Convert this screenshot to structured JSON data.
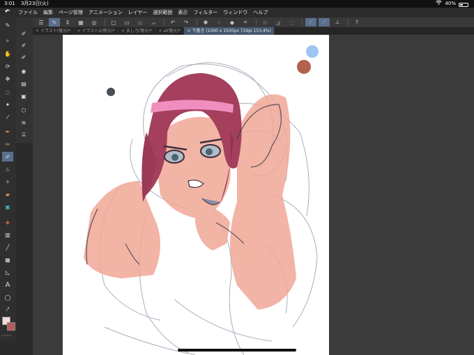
{
  "status": {
    "time": "3:01",
    "date": "3月23日(火)",
    "battery_percent": "40%",
    "battery_level": 0.4
  },
  "menubar": {
    "items": [
      "ファイル",
      "編集",
      "ページ管理",
      "アニメーション",
      "レイヤー",
      "選択範囲",
      "表示",
      "フィルター",
      "ウィンドウ",
      "ヘルプ"
    ]
  },
  "tabs": [
    {
      "label": "イラスト(復元)*",
      "active": false
    },
    {
      "label": "イラスト2(復元)*",
      "active": false
    },
    {
      "label": "ましろ(復元)*",
      "active": false
    },
    {
      "label": "ai(復元)*",
      "active": false
    },
    {
      "label": "下書き (1000 x 1500px 72dpi 153.4%)",
      "active": true
    }
  ],
  "colors": {
    "main_color": "#f4dcdc",
    "sub_color": "#b85a5a",
    "accent": "#5a6e8e",
    "canvas_swatches": [
      "#9fc6f2",
      "#b4604e",
      "#4a4e56"
    ]
  },
  "icons": {
    "logo": "clip-studio-logo-icon"
  }
}
